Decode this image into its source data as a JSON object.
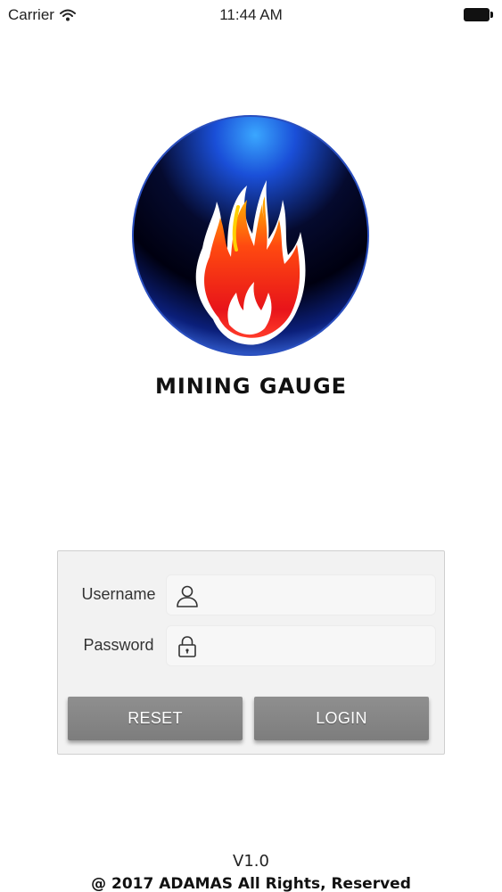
{
  "status_bar": {
    "carrier": "Carrier",
    "time": "11:44 AM",
    "wifi_icon": "wifi-icon",
    "battery_icon": "battery-full-icon"
  },
  "app": {
    "logo_icon": "flame-globe-logo",
    "title": "MINING GAUGE"
  },
  "login": {
    "username_label": "Username",
    "username_value": "",
    "username_icon": "user-icon",
    "password_label": "Password",
    "password_value": "",
    "password_icon": "lock-icon",
    "reset_label": "RESET",
    "login_label": "LOGIN"
  },
  "footer": {
    "version": "V1.0",
    "copyright": "@ 2017 ADAMAS All Rights, Reserved"
  },
  "colors": {
    "button": "#888888",
    "panel": "#f2f2f2",
    "globe": "#0a1a6e",
    "flame": "#e8231c"
  }
}
